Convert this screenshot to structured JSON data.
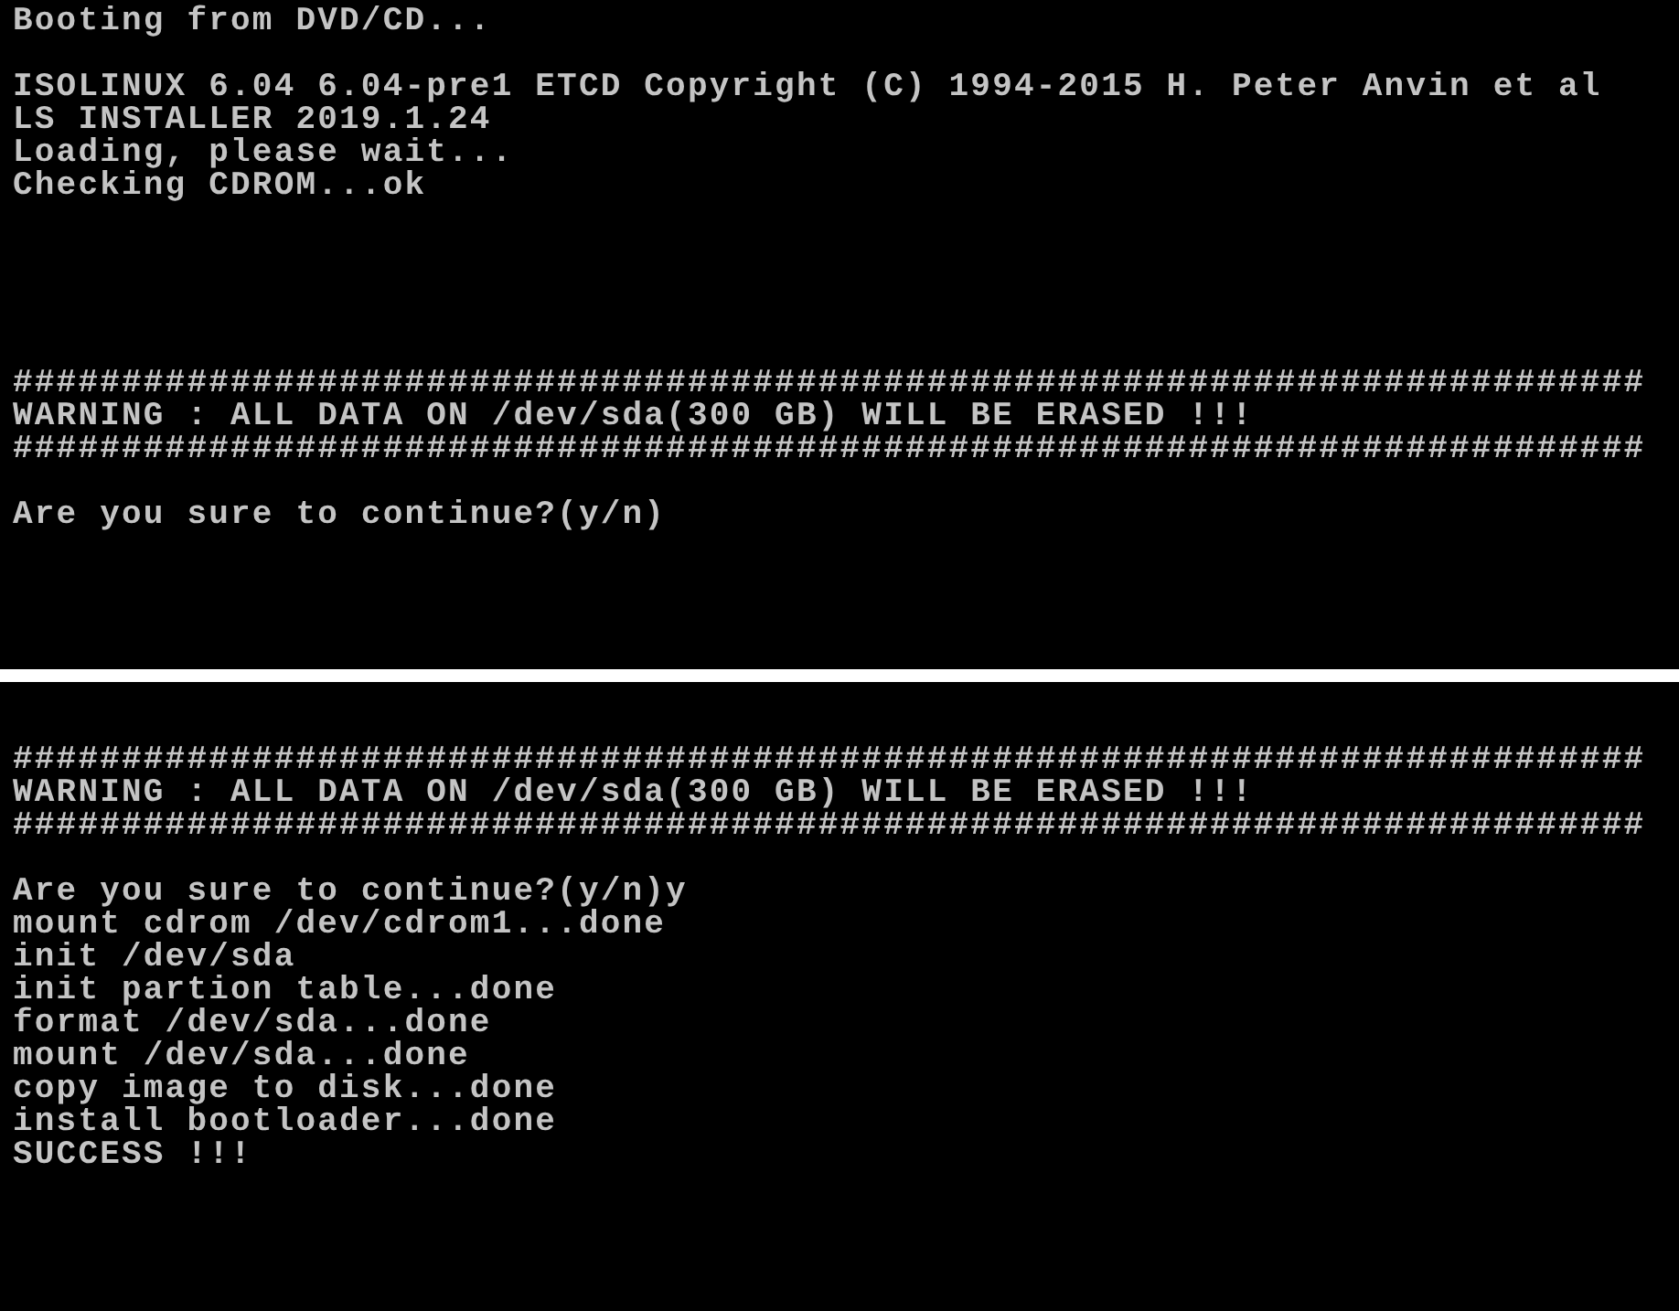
{
  "screens": [
    {
      "blocks": [
        [
          "Booting from DVD/CD..."
        ],
        [
          "ISOLINUX 6.04 6.04-pre1 ETCD Copyright (C) 1994-2015 H. Peter Anvin et al",
          "LS INSTALLER 2019.1.24",
          "Loading, please wait...",
          "Checking CDROM...ok"
        ],
        [
          "###########################################################################",
          "WARNING : ALL DATA ON /dev/sda(300 GB) WILL BE ERASED !!!",
          "###########################################################################"
        ],
        [
          "Are you sure to continue?(y/n)"
        ]
      ]
    },
    {
      "blocks": [
        [
          "###########################################################################",
          "WARNING : ALL DATA ON /dev/sda(300 GB) WILL BE ERASED !!!",
          "###########################################################################"
        ],
        [
          "Are you sure to continue?(y/n)y",
          "mount cdrom /dev/cdrom1...done",
          "init /dev/sda",
          "init partion table...done",
          "format /dev/sda...done",
          "mount /dev/sda...done",
          "copy image to disk...done",
          "install bootloader...done",
          "SUCCESS !!!"
        ]
      ]
    }
  ]
}
